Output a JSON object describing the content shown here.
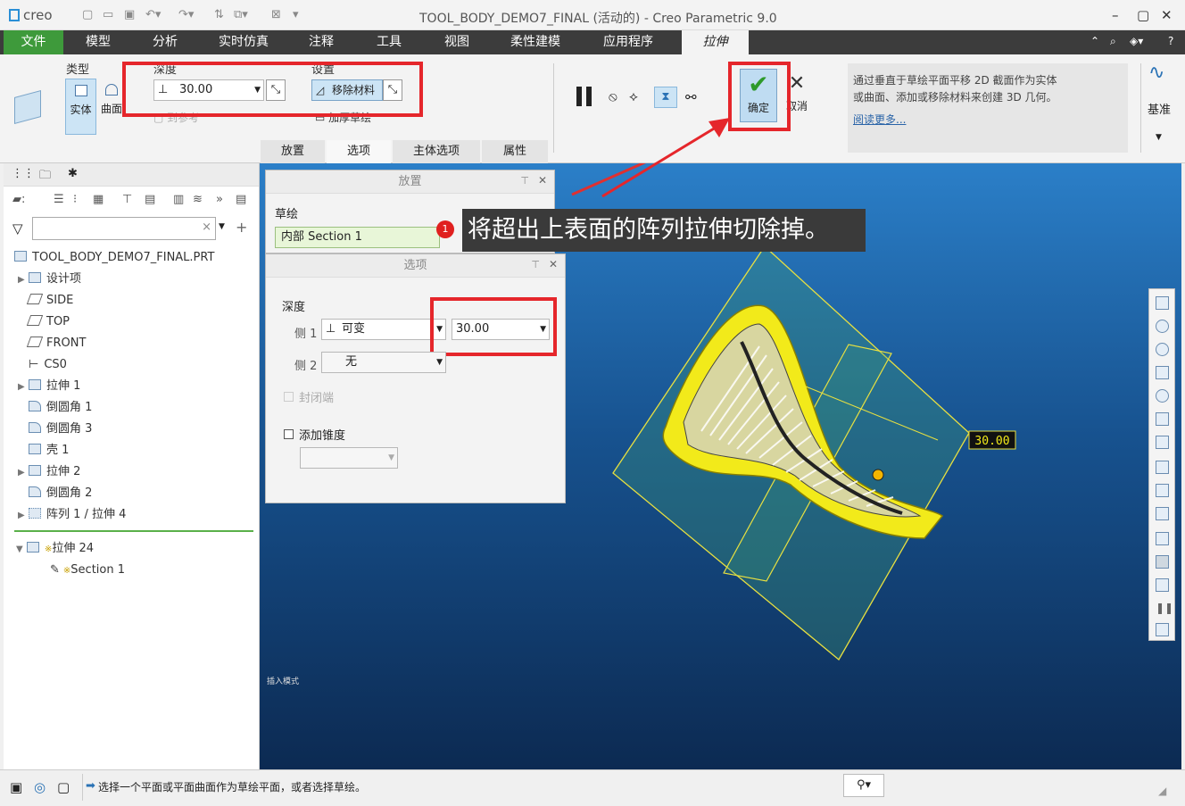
{
  "titlebar": {
    "app_logo": "creo",
    "window_title": "TOOL_BODY_DEMO7_FINAL (活动的) - Creo Parametric 9.0"
  },
  "menubar": {
    "items": [
      "文件",
      "模型",
      "分析",
      "实时仿真",
      "注释",
      "工具",
      "视图",
      "柔性建模",
      "应用程序",
      "拉伸"
    ]
  },
  "ribbon": {
    "type_label": "类型",
    "solid_label": "实体",
    "surface_label": "曲面",
    "depth_label": "深度",
    "depth_value": "30.00",
    "settings_label": "设置",
    "remove_material_label": "移除材料",
    "thicken_label": "加厚草绘",
    "ok_label": "确定",
    "cancel_label": "取消",
    "help_text": "通过垂直于草绘平面平移 2D 截面作为实体或曲面、添加或移除材料来创建 3D 几何。",
    "read_more": "阅读更多...",
    "datum_label": "基准",
    "subtabs": [
      "放置",
      "选项",
      "主体选项",
      "属性"
    ]
  },
  "tree": {
    "root": "TOOL_BODY_DEMO7_FINAL.PRT",
    "items": [
      "设计项",
      "SIDE",
      "TOP",
      "FRONT",
      "CS0",
      "拉伸 1",
      "倒圆角 1",
      "倒圆角 3",
      "壳 1",
      "拉伸 2",
      "倒圆角 2",
      "阵列 1 / 拉伸 4",
      "拉伸 24",
      "Section 1"
    ]
  },
  "placement_panel": {
    "title": "放置",
    "sketch_label": "草绘",
    "sketch_value": "内部 Section 1"
  },
  "options_panel": {
    "title": "选项",
    "depth_label": "深度",
    "side1_label": "侧 1",
    "side1_type": "可变",
    "side1_value": "30.00",
    "side2_label": "侧 2",
    "side2_value": "无",
    "capped_label": "封闭端",
    "taper_label": "添加锥度"
  },
  "annotation": {
    "badge": "1",
    "text": "将超出上表面的阵列拉伸切除掉。"
  },
  "viewport": {
    "dimension": "30.00",
    "corner_text": "插入模式"
  },
  "status": {
    "message": "选择一个平面或平面曲面作为草绘平面，或者选择草绘。"
  },
  "colors": {
    "file_tab": "#3e9a3b",
    "highlight": "#e5262b",
    "model": "#f2ea1a"
  }
}
